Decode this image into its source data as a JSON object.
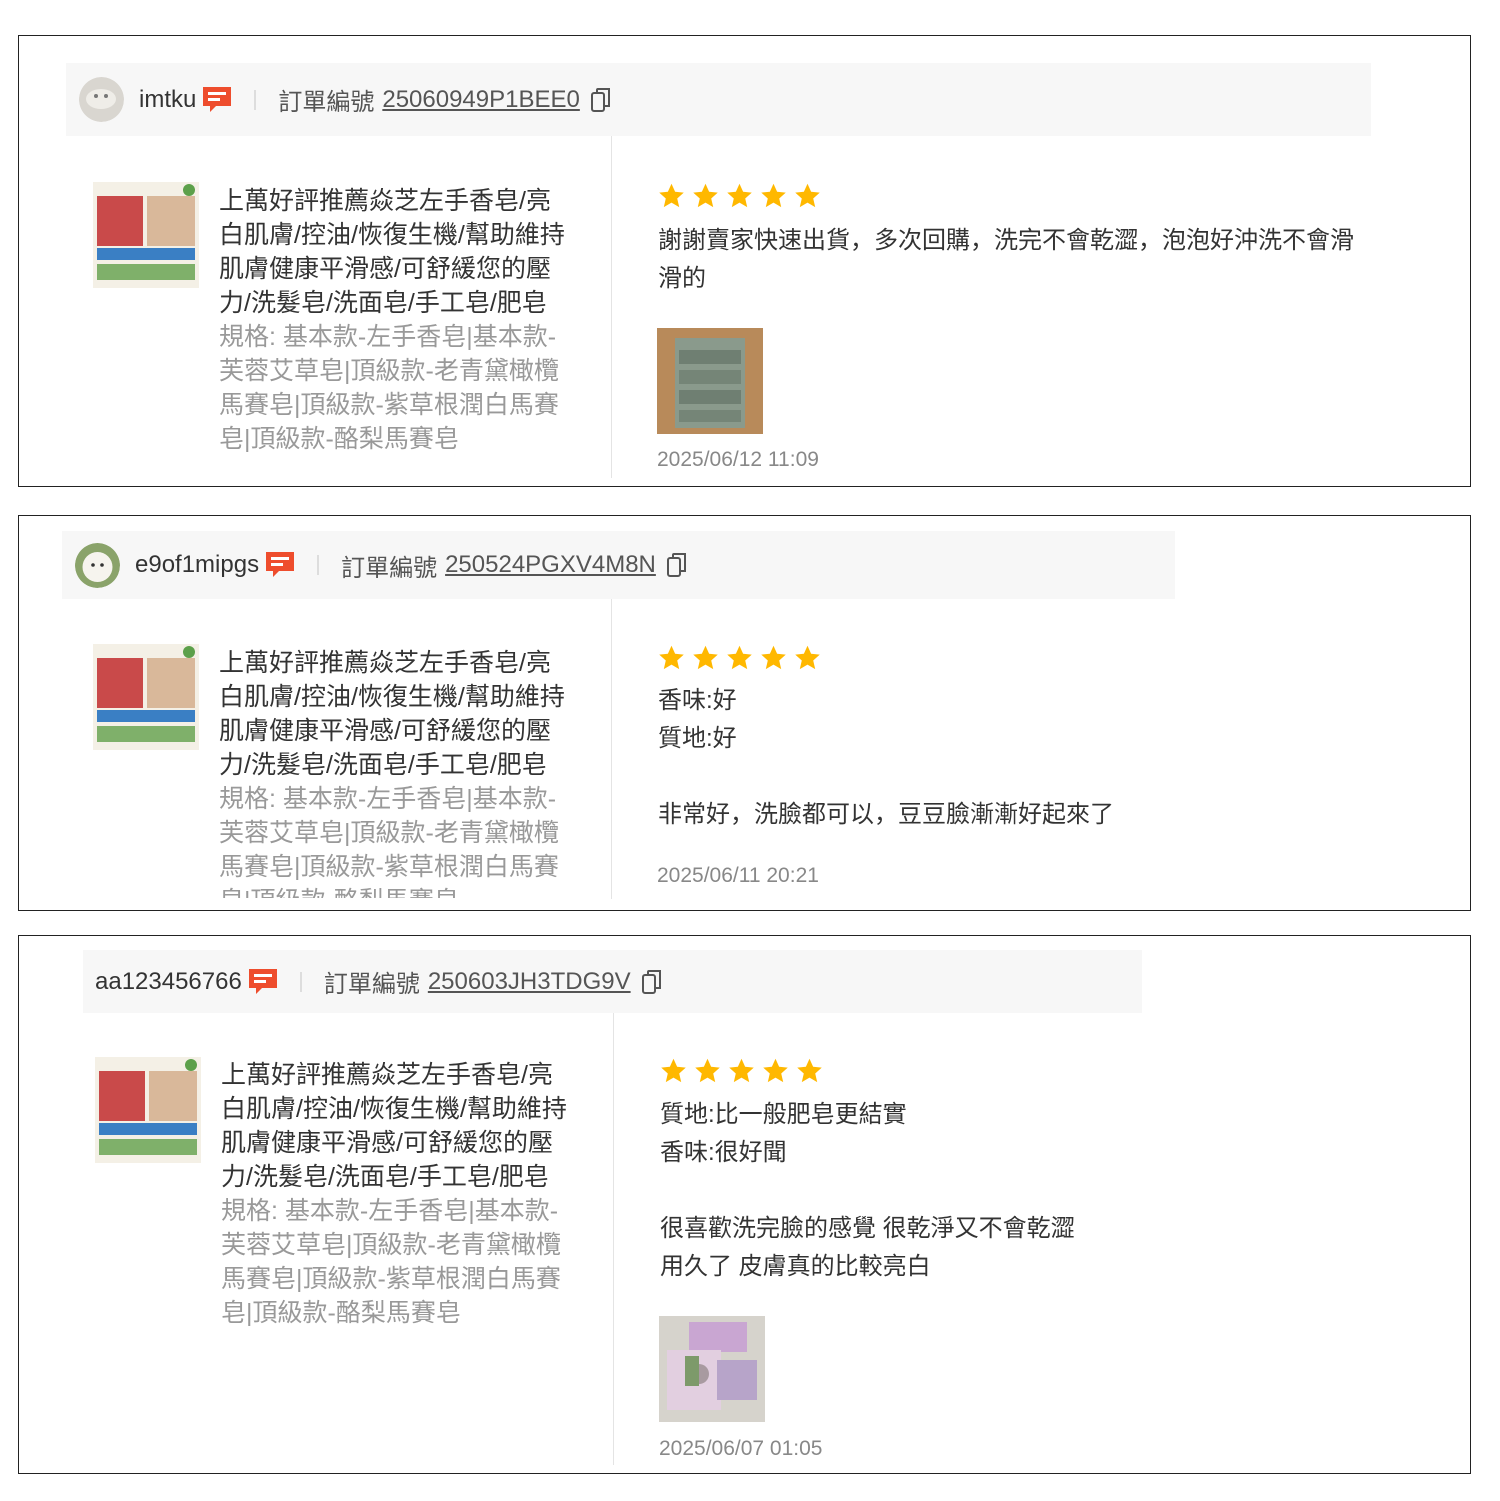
{
  "reviews": [
    {
      "username": "imtku",
      "order_label": "訂單編號",
      "order_number": "25060949P1BEE0",
      "product_title": "上萬好評推薦焱芝左手香皂/亮白肌膚/控油/恢復生機/幫助維持肌膚健康平滑感/可舒緩您的壓力/洗髮皂/洗面皂/手工皂/肥皂",
      "variation": "規格: 基本款-左手香皂|基本款-芙蓉艾草皂|頂級款-老青黛橄欖馬賽皂|頂級款-紫草根潤白馬賽皂|頂級款-酪梨馬賽皂",
      "rating": 5,
      "comment": "謝謝賣家快速出貨，多次回購，洗完不會乾澀，泡泡好沖洗不會滑滑的",
      "date": "2025/06/12 11:09",
      "has_photo": true
    },
    {
      "username": "e9of1mipgs",
      "order_label": "訂單編號",
      "order_number": "250524PGXV4M8N",
      "product_title": "上萬好評推薦焱芝左手香皂/亮白肌膚/控油/恢復生機/幫助維持肌膚健康平滑感/可舒緩您的壓力/洗髮皂/洗面皂/手工皂/肥皂",
      "variation": "規格: 基本款-左手香皂|基本款-芙蓉艾草皂|頂級款-老青黛橄欖馬賽皂|頂級款-紫草根潤白馬賽皂|頂級款-酪梨馬賽皂",
      "rating": 5,
      "comment": "香味:好\n質地:好\n\n非常好，洗臉都可以，豆豆臉漸漸好起來了",
      "date": "2025/06/11 20:21",
      "has_photo": false
    },
    {
      "username": "aa123456766",
      "order_label": "訂單編號",
      "order_number": "250603JH3TDG9V",
      "product_title": "上萬好評推薦焱芝左手香皂/亮白肌膚/控油/恢復生機/幫助維持肌膚健康平滑感/可舒緩您的壓力/洗髮皂/洗面皂/手工皂/肥皂",
      "variation": "規格: 基本款-左手香皂|基本款-芙蓉艾草皂|頂級款-老青黛橄欖馬賽皂|頂級款-紫草根潤白馬賽皂|頂級款-酪梨馬賽皂",
      "rating": 5,
      "comment": "質地:比一般肥皂更結實\n香味:很好聞\n\n很喜歡洗完臉的感覺 很乾淨又不會乾澀\n用久了 皮膚真的比較亮白",
      "date": "2025/06/07 01:05",
      "has_photo": true
    }
  ],
  "colors": {
    "star": "#ffb800",
    "chat_icon": "#ee4d2d",
    "header_bg": "#f7f7f7"
  },
  "icons": {
    "chat": "chat-bubble-icon",
    "copy": "copy-icon",
    "star": "star-icon"
  }
}
